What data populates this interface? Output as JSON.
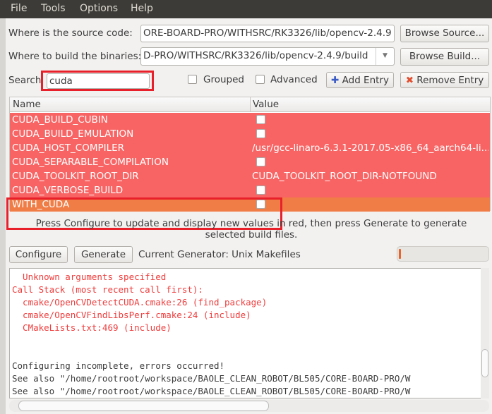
{
  "menu": [
    "File",
    "Tools",
    "Options",
    "Help"
  ],
  "source": {
    "label": "Where is the source code:",
    "value": "ORE-BOARD-PRO/WITHSRC/RK3326/lib/opencv-2.4.9",
    "button": "Browse Source..."
  },
  "build": {
    "label": "Where to build the binaries:",
    "value": "D-PRO/WITHSRC/RK3326/lib/opencv-2.4.9/build",
    "button": "Browse Build..."
  },
  "search": {
    "label": "Search",
    "value": "cuda",
    "grouped": "Grouped",
    "advanced": "Advanced",
    "add_entry": "Add Entry",
    "remove_entry": "Remove Entry"
  },
  "table": {
    "headers": [
      "Name",
      "Value"
    ],
    "rows": [
      {
        "name": "CUDA_BUILD_CUBIN",
        "type": "bool",
        "checked": false
      },
      {
        "name": "CUDA_BUILD_EMULATION",
        "type": "bool",
        "checked": false
      },
      {
        "name": "CUDA_HOST_COMPILER",
        "type": "text",
        "value": "/usr/gcc-linaro-6.3.1-2017.05-x86_64_aarch64-li..."
      },
      {
        "name": "CUDA_SEPARABLE_COMPILATION",
        "type": "bool",
        "checked": false
      },
      {
        "name": "CUDA_TOOLKIT_ROOT_DIR",
        "type": "text",
        "value": "CUDA_TOOLKIT_ROOT_DIR-NOTFOUND"
      },
      {
        "name": "CUDA_VERBOSE_BUILD",
        "type": "bool",
        "checked": false
      },
      {
        "name": "WITH_CUDA",
        "type": "bool",
        "checked": false,
        "selected": true
      }
    ]
  },
  "colors": {
    "new_row": "#f86464",
    "selected_row": "#f07d46",
    "highlight_box": "#e8202a"
  },
  "message": "Press Configure to update and display new values in red, then press Generate to generate selected build files.",
  "configure": "Configure",
  "generate": "Generate",
  "generator": "Current Generator: Unix Makefiles",
  "progress": 0,
  "output": [
    {
      "text": "  Unknown arguments specified",
      "color": "red"
    },
    {
      "text": "Call Stack (most recent call first):",
      "color": "red"
    },
    {
      "text": "  cmake/OpenCVDetectCUDA.cmake:26 (find_package)",
      "color": "red"
    },
    {
      "text": "  cmake/OpenCVFindLibsPerf.cmake:24 (include)",
      "color": "red"
    },
    {
      "text": "  CMakeLists.txt:469 (include)",
      "color": "red"
    },
    {
      "text": "",
      "color": "blk"
    },
    {
      "text": "",
      "color": "blk"
    },
    {
      "text": "Configuring incomplete, errors occurred!",
      "color": "blk"
    },
    {
      "text": "See also \"/home/rootroot/workspace/BAOLE_CLEAN_ROBOT/BL505/CORE-BOARD-PRO/W",
      "color": "blk"
    },
    {
      "text": "See also \"/home/rootroot/workspace/BAOLE_CLEAN_ROBOT/BL505/CORE-BOARD-PRO/W",
      "color": "blk"
    }
  ]
}
